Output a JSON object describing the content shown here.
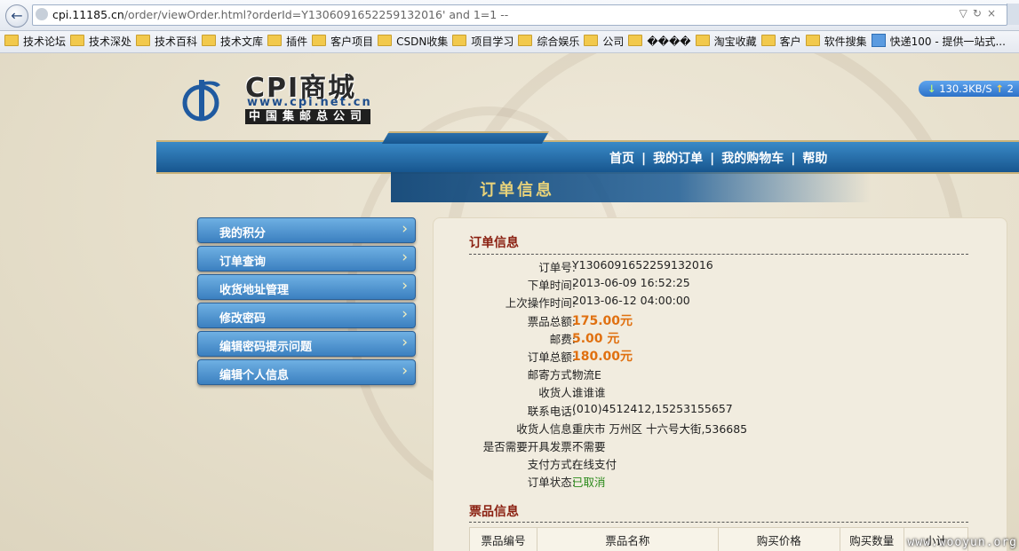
{
  "browser": {
    "url_host": "cpi.11185.cn",
    "url_path": "/order/viewOrder.html?orderId=Y1306091652259132016' and 1=1 --",
    "bookmarks": [
      {
        "label": "技术论坛",
        "icon": "folder-icon"
      },
      {
        "label": "技术深处",
        "icon": "folder-icon"
      },
      {
        "label": "技术百科",
        "icon": "folder-icon"
      },
      {
        "label": "技术文库",
        "icon": "folder-icon"
      },
      {
        "label": "插件",
        "icon": "folder-icon"
      },
      {
        "label": "客户项目",
        "icon": "folder-icon"
      },
      {
        "label": "CSDN收集",
        "icon": "folder-icon"
      },
      {
        "label": "项目学习",
        "icon": "folder-icon"
      },
      {
        "label": "综合娱乐",
        "icon": "folder-icon"
      },
      {
        "label": "公司",
        "icon": "folder-icon"
      },
      {
        "label": "����",
        "icon": "folder-icon"
      },
      {
        "label": "淘宝收藏",
        "icon": "folder-icon"
      },
      {
        "label": "客户",
        "icon": "folder-icon"
      },
      {
        "label": "软件搜集",
        "icon": "folder-icon"
      },
      {
        "label": "快递100 - 提供一站式...",
        "icon": "page-icon"
      }
    ]
  },
  "header": {
    "logo_title": "CPI商城",
    "logo_url": "www.cpi.net.cn",
    "logo_sub": "中国集邮总公司",
    "speed": "130.3KB/S",
    "speed_extra": "2",
    "nav": [
      "首页",
      "我的订单",
      "我的购物车",
      "帮助"
    ],
    "nav_separator": "|",
    "section_title": "订单信息"
  },
  "sidebar": {
    "items": [
      "我的积分",
      "订单查询",
      "收货地址管理",
      "修改密码",
      "编辑密码提示问题",
      "编辑个人信息"
    ],
    "chevron": "›"
  },
  "order": {
    "title": "订单信息",
    "fields": [
      {
        "label": "订单号:",
        "value": "Y1306091652259132016",
        "style": "normal"
      },
      {
        "label": "下单时间:",
        "value": "2013-06-09 16:52:25",
        "style": "normal"
      },
      {
        "label": "上次操作时间:",
        "value": "2013-06-12 04:00:00",
        "style": "normal"
      },
      {
        "label": "票品总额:",
        "value": "175.00元",
        "style": "money"
      },
      {
        "label": "邮费:",
        "value": "5.00 元",
        "style": "money"
      },
      {
        "label": "订单总额:",
        "value": "180.00元",
        "style": "money"
      },
      {
        "label": "邮寄方式:",
        "value": "物流E",
        "style": "normal"
      },
      {
        "label": "收货人:",
        "value": "谁谁谁",
        "style": "normal"
      },
      {
        "label": "联系电话:",
        "value": "(010)4512412,15253155657",
        "style": "normal"
      },
      {
        "label": "收货人信息:",
        "value": "重庆市 万州区 十六号大街,536685",
        "style": "normal"
      },
      {
        "label": "是否需要开具发票:",
        "value": "不需要",
        "style": "normal"
      },
      {
        "label": "支付方式:",
        "value": "在线支付",
        "style": "normal"
      },
      {
        "label": "订单状态:",
        "value": "已取消",
        "style": "cancel"
      }
    ]
  },
  "tickets": {
    "title": "票品信息",
    "columns": [
      "票品编号",
      "票品名称",
      "购买价格",
      "购买数量",
      "小计"
    ]
  },
  "watermark": "www.wooyun.org"
}
